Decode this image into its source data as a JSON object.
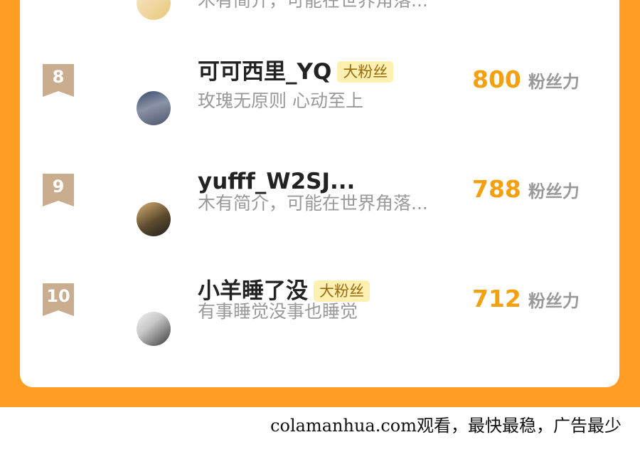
{
  "ranking": {
    "top_partial_row": {
      "intro": "木有简介，可能在世界角落..."
    },
    "rows": [
      {
        "rank": "8",
        "name": "可可西里_YQ",
        "tag": "大粉丝",
        "intro": "玫瑰无原则 心动至上",
        "score": "800",
        "unit": "粉丝力"
      },
      {
        "rank": "9",
        "name": "yufff_W2SJ...",
        "tag": "",
        "intro": "木有简介，可能在世界角落...",
        "score": "788",
        "unit": "粉丝力"
      },
      {
        "rank": "10",
        "name": "小羊睡了没",
        "tag": "大粉丝",
        "intro": "有事睡觉没事也睡觉",
        "score": "712",
        "unit": "粉丝力"
      }
    ]
  },
  "footer": {
    "text": "colamanhua.com观看，最快最稳，广告最少"
  },
  "colors": {
    "background": "#ff9d24",
    "score": "#f5a00e",
    "badge": "#c9ad8f",
    "tag_bg": "#fdf0b0"
  }
}
